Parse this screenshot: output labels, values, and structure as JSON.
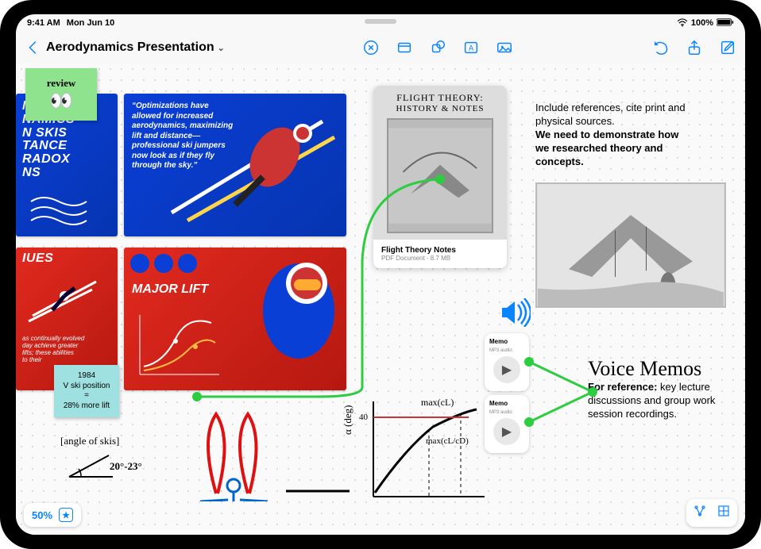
{
  "statusbar": {
    "time": "9:41 AM",
    "date": "Mon Jun 10",
    "battery": "100%"
  },
  "toolbar": {
    "back": "‹",
    "title": "Aerodynamics Presentation"
  },
  "sticky_review": {
    "label": "review",
    "emoji": "👀"
  },
  "sticky_lift": {
    "l1": "1984",
    "l2": "V ski position",
    "l3": "=",
    "l4": "28% more lift"
  },
  "slides": {
    "top_left_lines": "NS\nNAMICS\nN SKIS\nTANCE\nRADOX\nNS",
    "quote": "“Optimizations have allowed for increased aerodynamics, maximizing lift and distance—professional ski jumpers now look as if they fly through the sky.”",
    "mid_left_title": "IUES",
    "mid_left_body": "as continually evolved\nday achieve greater\nlifts; these abilities\nto their",
    "major_lift": "MAJOR LIFT"
  },
  "document": {
    "cover_t1": "FLIGHT THEORY:",
    "cover_t2": "HISTORY & NOTES",
    "filename": "Flight Theory Notes",
    "subtitle": "PDF Document · 8.7 MB"
  },
  "note_refs": {
    "line1": "Include references, cite print and physical sources.",
    "line2": "We need to demonstrate how we researched theory and concepts."
  },
  "memos": {
    "heading": "Voice Memos",
    "body": "For reference:",
    "body2": "key lecture discussions and group work session recordings.",
    "item_label": "Memo",
    "item_sub": "MP3 audio"
  },
  "hand": {
    "angle_label": "[angle of skis]",
    "angle_val": "20°-23°",
    "graph_y": "α (deg)",
    "graph_y40": "40",
    "graph_max1": "max(cL)",
    "graph_max2": "max(cL/cD)"
  },
  "zoom": {
    "pct": "50%",
    "star": "★"
  }
}
